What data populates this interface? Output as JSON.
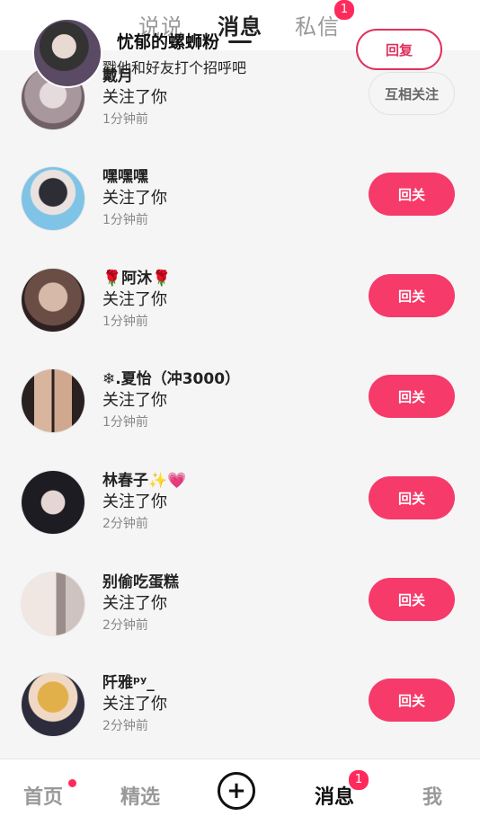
{
  "top_tabs": [
    {
      "label": "说说",
      "active": false
    },
    {
      "label": "消息",
      "active": true
    },
    {
      "label": "私信",
      "active": false,
      "badge": "1"
    }
  ],
  "overlay_notification": {
    "name": "忧郁的螺蛳粉",
    "subtitle": "戳他和好友打个招呼吧",
    "button_label": "回复"
  },
  "notifications": [
    {
      "name": "戴月",
      "action": "关注了你",
      "time": "1分钟前",
      "button": "互相关注",
      "mutual": true,
      "avatar_colors": [
        "#d9cfd0",
        "#8e7f86"
      ]
    },
    {
      "name": "嘿嘿嘿",
      "action": "关注了你",
      "time": "1分钟前",
      "button": "回关",
      "mutual": false,
      "avatar_colors": [
        "#7fc3e6",
        "#2f3f55"
      ]
    },
    {
      "name": "🌹阿沐🌹",
      "action": "关注了你",
      "time": "1分钟前",
      "button": "回关",
      "mutual": false,
      "avatar_colors": [
        "#b08a77",
        "#3d2a2a"
      ]
    },
    {
      "name": "❄.夏怡（冲3000）",
      "action": "关注了你",
      "time": "1分钟前",
      "button": "回关",
      "mutual": false,
      "avatar_colors": [
        "#c9a78d",
        "#2a2020"
      ]
    },
    {
      "name": "林春子✨💗",
      "action": "关注了你",
      "time": "2分钟前",
      "button": "回关",
      "mutual": false,
      "avatar_colors": [
        "#d8c7c4",
        "#1c1c22"
      ]
    },
    {
      "name": "别偷吃蛋糕",
      "action": "关注了你",
      "time": "2分钟前",
      "button": "回关",
      "mutual": false,
      "avatar_colors": [
        "#e9dcd6",
        "#7a6a66"
      ]
    },
    {
      "name": "阡雅ᵖʸ_",
      "action": "关注了你",
      "time": "2分钟前",
      "button": "回关",
      "mutual": false,
      "avatar_colors": [
        "#e2b04a",
        "#2c2c3c"
      ]
    }
  ],
  "bottom_nav": [
    {
      "label": "首页",
      "active": false,
      "dot": true
    },
    {
      "label": "精选",
      "active": false
    },
    {
      "label": "+",
      "icon": "plus-icon"
    },
    {
      "label": "消息",
      "active": true,
      "badge": "1"
    },
    {
      "label": "我",
      "active": false
    }
  ],
  "colors": {
    "accent": "#f63a6a",
    "badge": "#ff2a5c"
  }
}
